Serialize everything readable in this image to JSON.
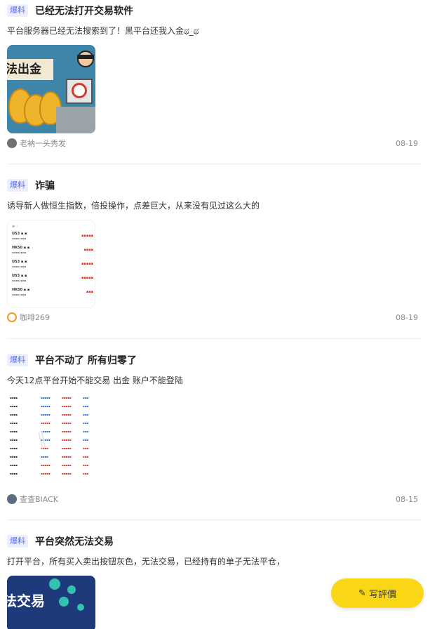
{
  "posts": [
    {
      "tag": "爆料",
      "title": "已经无法打开交易软件",
      "desc": "平台服务器已经无法搜索到了！黑平台还我入金ಥ_ಥ",
      "image_text": "法出金",
      "author": "老衲一头秀发",
      "date": "08-19"
    },
    {
      "tag": "爆料",
      "title": "诈骗",
      "desc": "诱导新人做恒生指数，倍投操作，点差巨大，从来没有见过这么大的",
      "author": "咖啡269",
      "date": "08-19"
    },
    {
      "tag": "爆料",
      "title": "平台不动了 所有归零了",
      "desc": "今天12点平台开始不能交易 出金 账户不能登陆",
      "author": "查查BIACK",
      "date": "08-15"
    },
    {
      "tag": "爆料",
      "title": "平台突然无法交易",
      "desc": "打开平台，所有买入卖出按钮灰色，无法交易，已经持有的单子无法平仓，",
      "image_text": "法交易"
    }
  ],
  "fab": {
    "label": "写評價",
    "icon": "pen-icon"
  },
  "colors": {
    "tag_text": "#5a6df0",
    "tag_bg": "#eaeefe",
    "fab_bg": "#f9d616",
    "loss_red": "#d9372a"
  }
}
